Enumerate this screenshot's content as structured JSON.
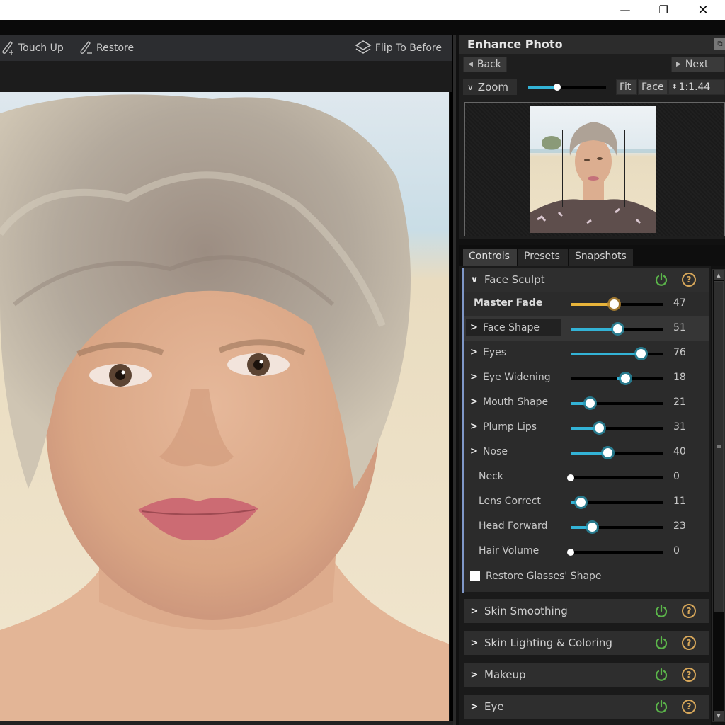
{
  "window": {
    "minimize_icon": "minimize-icon",
    "restore_icon": "restore-icon",
    "close_icon": "close-icon",
    "minimize_glyph": "—",
    "restore_glyph": "❐",
    "close_glyph": "✕"
  },
  "toolbar": {
    "touch_up_label": "Touch Up",
    "restore_label": "Restore",
    "flip_label": "Flip To Before"
  },
  "panel": {
    "title": "Enhance Photo",
    "dock_glyph": "⧉",
    "back_label": "Back",
    "next_label": "Next",
    "zoom_label": "Zoom",
    "zoom_slider_value": 0.37,
    "fit_label": "Fit",
    "face_label": "Face",
    "zoom_ratio": "1:1.44"
  },
  "tabs": [
    {
      "label": "Controls",
      "active": true
    },
    {
      "label": "Presets",
      "active": false
    },
    {
      "label": "Snapshots",
      "active": false
    }
  ],
  "face_sculpt": {
    "title": "Face Sculpt",
    "expanded": true,
    "master_fade": {
      "label": "Master Fade",
      "value": 47
    },
    "sliders": [
      {
        "label": "Face Shape",
        "value": 51,
        "expandable": true,
        "bipolar": false
      },
      {
        "label": "Eyes",
        "value": 76,
        "expandable": true,
        "bipolar": false
      },
      {
        "label": "Eye Widening",
        "value": 18,
        "expandable": true,
        "bipolar": true
      },
      {
        "label": "Mouth Shape",
        "value": 21,
        "expandable": true,
        "bipolar": false
      },
      {
        "label": "Plump Lips",
        "value": 31,
        "expandable": true,
        "bipolar": false
      },
      {
        "label": "Nose",
        "value": 40,
        "expandable": true,
        "bipolar": false
      },
      {
        "label": "Neck",
        "value": 0,
        "expandable": false,
        "bipolar": false
      },
      {
        "label": "Lens Correct",
        "value": 11,
        "expandable": false,
        "bipolar": false
      },
      {
        "label": "Head Forward",
        "value": 23,
        "expandable": false,
        "bipolar": false
      },
      {
        "label": "Hair Volume",
        "value": 0,
        "expandable": false,
        "bipolar": false
      }
    ],
    "restore_glasses_label": "Restore Glasses' Shape",
    "restore_glasses_checked": false
  },
  "sections": [
    {
      "title": "Skin Smoothing"
    },
    {
      "title": "Skin Lighting & Coloring"
    },
    {
      "title": "Makeup"
    },
    {
      "title": "Eye"
    }
  ],
  "colors": {
    "accent_blue": "#33b3d6",
    "master_gold": "#e8b43a",
    "power_green": "#5bb54a",
    "help_gold": "#d7a75a"
  }
}
